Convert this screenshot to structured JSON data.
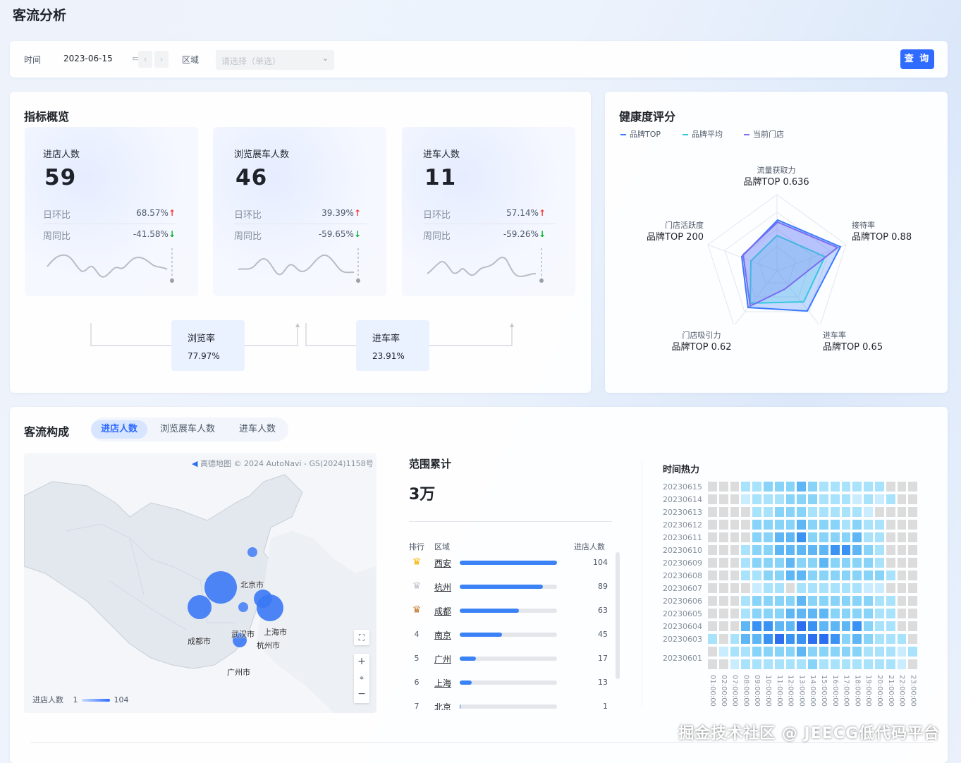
{
  "page": {
    "title": "客流分析",
    "watermark": "掘金技术社区 @ JEECG低代码平台"
  },
  "filter": {
    "time_label": "时间",
    "date_value": "2023-06-15",
    "region_label": "区域",
    "region_placeholder": "请选择（单选）",
    "query_button": "查 询",
    "icons": {
      "calendar": "calendar-icon",
      "prev": "chevron-left-icon",
      "next": "chevron-right-icon",
      "dropdown": "chevron-down-icon"
    }
  },
  "indicators": {
    "title": "指标概览",
    "metrics": [
      {
        "label": "进店人数",
        "value": "59",
        "dod_label": "日环比",
        "dod": "68.57%",
        "dod_dir": "↑",
        "wow_label": "周同比",
        "wow": "-41.58%",
        "wow_dir": "↓"
      },
      {
        "label": "浏览展车人数",
        "value": "46",
        "dod_label": "日环比",
        "dod": "39.39%",
        "dod_dir": "↑",
        "wow_label": "周同比",
        "wow": "-59.65%",
        "wow_dir": "↓"
      },
      {
        "label": "进车人数",
        "value": "11",
        "dod_label": "日环比",
        "dod": "57.14%",
        "dod_dir": "↑",
        "wow_label": "周同比",
        "wow": "-59.26%",
        "wow_dir": "↓"
      }
    ],
    "rates": [
      {
        "label": "浏览率",
        "value": "77.97%"
      },
      {
        "label": "进车率",
        "value": "23.91%"
      }
    ]
  },
  "health": {
    "title": "健康度评分",
    "legend": [
      {
        "name": "品牌TOP",
        "color": "#3a7bff"
      },
      {
        "name": "品牌平均",
        "color": "#36c7e0"
      },
      {
        "name": "当前门店",
        "color": "#7b6cf0"
      }
    ],
    "axes": [
      {
        "name": "流量获取力",
        "value": "品牌TOP 0.636"
      },
      {
        "name": "接待率",
        "value": "品牌TOP 0.88"
      },
      {
        "name": "进车率",
        "value": "品牌TOP 0.65"
      },
      {
        "name": "门店吸引力",
        "value": "品牌TOP 0.62"
      },
      {
        "name": "门店活跃度",
        "value": "品牌TOP 200"
      }
    ]
  },
  "flow": {
    "title": "客流构成",
    "tabs": [
      {
        "label": "进店人数",
        "active": true
      },
      {
        "label": "浏览展车人数",
        "active": false
      },
      {
        "label": "进车人数",
        "active": false
      }
    ],
    "map": {
      "attribution": "高德地图 © 2024 AutoNavi - GS(2024)1158号",
      "cities": [
        "北京市",
        "成都市",
        "武汉市",
        "上海市",
        "杭州市",
        "广州市"
      ],
      "legend_label": "进店人数",
      "legend_min": "1",
      "legend_max": "104"
    },
    "summary": {
      "title": "范围累计",
      "value": "3万"
    },
    "ranking": {
      "headers": {
        "rank": "排行",
        "region": "区域",
        "count": "进店人数"
      },
      "rows": [
        {
          "rank": "crown-gold-icon",
          "region": "西安",
          "value": 104,
          "display": "104"
        },
        {
          "rank": "crown-silver-icon",
          "region": "杭州",
          "value": 89,
          "display": "89"
        },
        {
          "rank": "crown-bronze-icon",
          "region": "成都",
          "value": 63,
          "display": "63"
        },
        {
          "rank": "4",
          "region": "南京",
          "value": 45,
          "display": "45"
        },
        {
          "rank": "5",
          "region": "广州",
          "value": 17,
          "display": "17"
        },
        {
          "rank": "6",
          "region": "上海",
          "value": 13,
          "display": "13"
        },
        {
          "rank": "7",
          "region": "北京",
          "value": 1,
          "display": "1"
        }
      ],
      "max": 104
    },
    "heat": {
      "title": "时间热力",
      "rows": [
        "20230615",
        "20230614",
        "20230613",
        "20230612",
        "20230611",
        "20230610",
        "20230609",
        "20230608",
        "20230607",
        "20230606",
        "20230605",
        "20230604",
        "20230603",
        "20230601"
      ],
      "x_labels": [
        "01:00:00",
        "02:00:00",
        "07:00:00",
        "08:00:00",
        "09:00:00",
        "10:00:00",
        "11:00:00",
        "12:00:00",
        "13:00:00",
        "14:00:00",
        "15:00:00",
        "16:00:00",
        "17:00:00",
        "18:00:00",
        "19:00:00",
        "20:00:00",
        "21:00:00",
        "22:00:00",
        "23:00:00"
      ],
      "colors": [
        "#dcdcdc",
        "#c9ecff",
        "#a8e2fb",
        "#88d3f8",
        "#5fb6f5",
        "#3a92f2",
        "#2b6ff0"
      ],
      "levels": [
        [
          0,
          0,
          0,
          2,
          2,
          3,
          3,
          3,
          4,
          3,
          2,
          2,
          2,
          2,
          2,
          2,
          0,
          0,
          0
        ],
        [
          0,
          0,
          0,
          1,
          2,
          2,
          2,
          3,
          3,
          3,
          2,
          2,
          2,
          1,
          2,
          1,
          2,
          0,
          0
        ],
        [
          0,
          0,
          0,
          0,
          2,
          2,
          3,
          3,
          3,
          2,
          2,
          2,
          2,
          2,
          1,
          0,
          0,
          0,
          0
        ],
        [
          0,
          0,
          0,
          0,
          3,
          3,
          3,
          3,
          4,
          3,
          3,
          3,
          2,
          3,
          2,
          2,
          0,
          0,
          0
        ],
        [
          0,
          0,
          0,
          0,
          3,
          3,
          4,
          4,
          5,
          3,
          3,
          3,
          3,
          4,
          2,
          2,
          0,
          0,
          0
        ],
        [
          0,
          0,
          0,
          2,
          3,
          3,
          4,
          4,
          4,
          4,
          4,
          5,
          5,
          4,
          3,
          2,
          0,
          0,
          0
        ],
        [
          0,
          0,
          0,
          2,
          3,
          3,
          3,
          4,
          3,
          3,
          4,
          3,
          3,
          3,
          3,
          2,
          0,
          0,
          0
        ],
        [
          0,
          0,
          0,
          2,
          2,
          3,
          3,
          4,
          4,
          3,
          3,
          3,
          3,
          3,
          3,
          3,
          2,
          0,
          0
        ],
        [
          0,
          0,
          0,
          0,
          1,
          2,
          2,
          0,
          2,
          2,
          2,
          2,
          2,
          2,
          1,
          1,
          0,
          0,
          0
        ],
        [
          0,
          0,
          0,
          2,
          3,
          3,
          3,
          3,
          4,
          3,
          3,
          3,
          3,
          3,
          3,
          2,
          2,
          0,
          0
        ],
        [
          0,
          0,
          0,
          2,
          3,
          3,
          3,
          4,
          4,
          4,
          4,
          3,
          3,
          3,
          3,
          2,
          2,
          0,
          0
        ],
        [
          0,
          0,
          0,
          4,
          5,
          5,
          4,
          4,
          6,
          5,
          4,
          4,
          4,
          5,
          3,
          2,
          2,
          0,
          0
        ],
        [
          2,
          0,
          2,
          4,
          4,
          5,
          6,
          5,
          5,
          6,
          6,
          5,
          3,
          4,
          3,
          2,
          2,
          2,
          0
        ],
        [
          0,
          1,
          2,
          2,
          3,
          3,
          3,
          3,
          4,
          3,
          3,
          3,
          3,
          3,
          2,
          2,
          2,
          1,
          2
        ],
        [
          0,
          0,
          1,
          2,
          2,
          2,
          2,
          2,
          2,
          3,
          2,
          2,
          2,
          2,
          2,
          2,
          2,
          1,
          0
        ]
      ]
    }
  }
}
